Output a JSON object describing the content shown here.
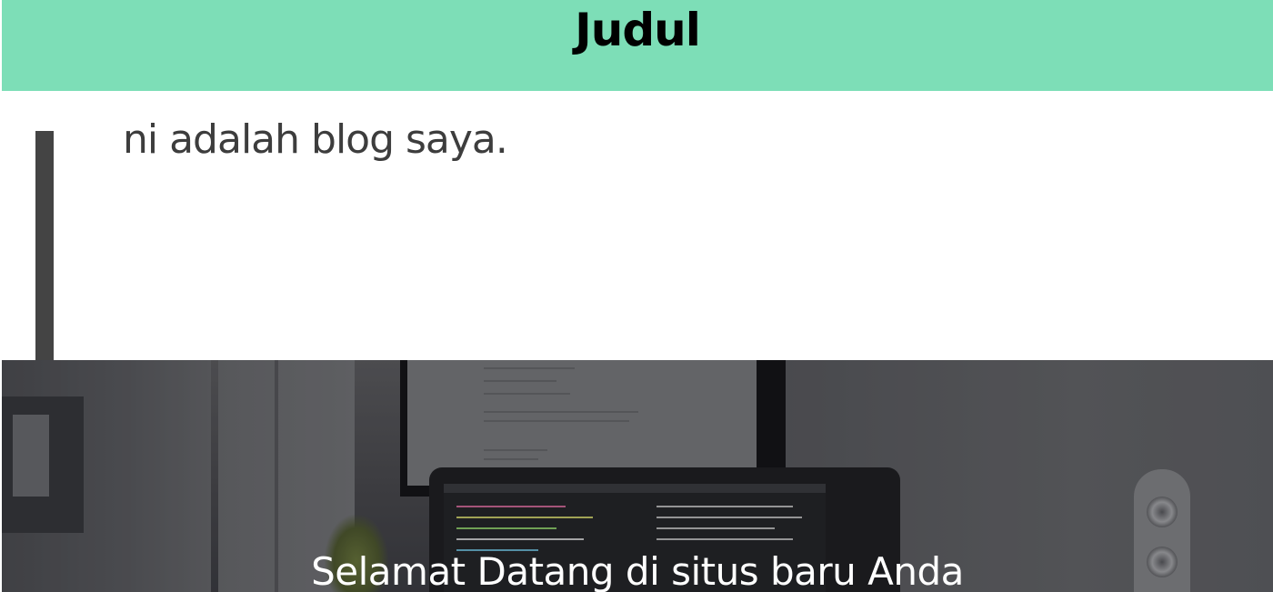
{
  "header": {
    "title": "Judul"
  },
  "content": {
    "intro_text": "ni adalah blog saya."
  },
  "hero": {
    "title": "Selamat Datang di situs baru Anda",
    "background_image": "desk-workspace-photo"
  },
  "colors": {
    "header_background": "#7ddeb7",
    "quote_bar": "#444444",
    "intro_text": "#3d3d3d",
    "hero_text": "#ffffff"
  }
}
